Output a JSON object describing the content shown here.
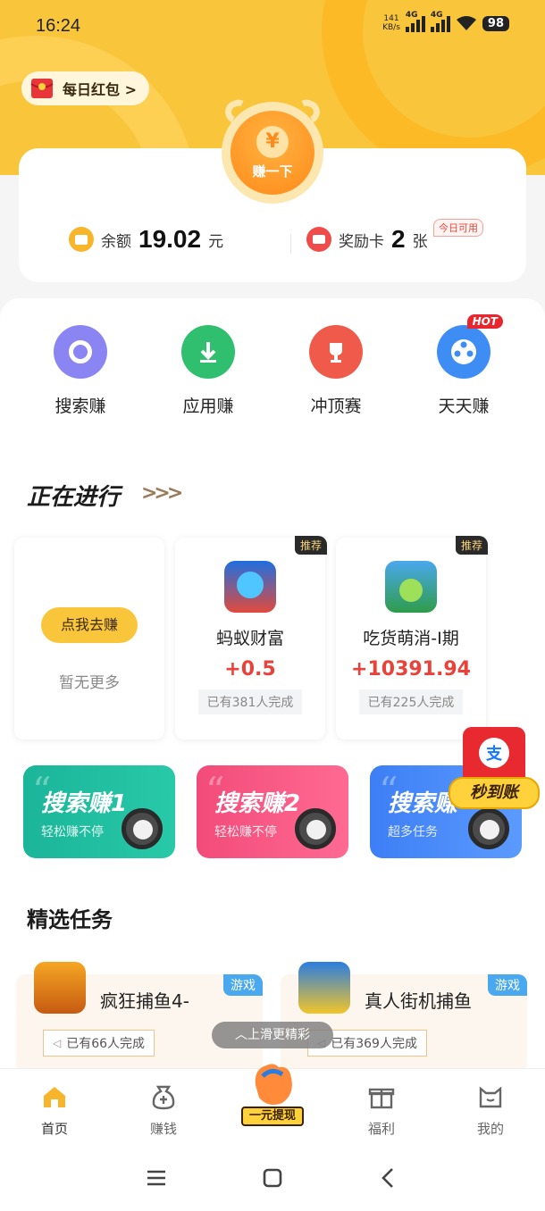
{
  "status": {
    "time": "16:24",
    "speed": "141",
    "speed_unit": "KB/s",
    "net1": "4G",
    "net2": "4G",
    "battery": "98"
  },
  "header": {
    "daily_redpacket": "每日红包 >",
    "coin_label": "赚一下",
    "coin_symbol": "¥"
  },
  "balance": {
    "label": "余额",
    "value": "19.02",
    "unit": "元",
    "card_label": "奖励卡",
    "card_value": "2",
    "card_unit": "张",
    "badge": "今日可用"
  },
  "quick": [
    {
      "label": "搜索赚",
      "icon": "search-icon",
      "color": "#7b7ff0"
    },
    {
      "label": "应用赚",
      "icon": "download-icon",
      "color": "#2fbf6e"
    },
    {
      "label": "冲顶赛",
      "icon": "trophy-icon",
      "color": "#f05a4a"
    },
    {
      "label": "天天赚",
      "icon": "film-reel-icon",
      "color": "#3d8df5",
      "badge": "HOT"
    }
  ],
  "ongoing": {
    "title": "正在进行",
    "arrows": ">>>",
    "empty_button": "点我去赚",
    "empty_text": "暂无更多",
    "items": [
      {
        "name": "蚂蚁财富",
        "reward": "+0.5",
        "done": "已有381人完成",
        "tag": "推荐"
      },
      {
        "name": "吃货萌消-Ⅰ期",
        "reward": "+10391.94",
        "done": "已有225人完成",
        "tag": "推荐"
      }
    ]
  },
  "banners": [
    {
      "title": "搜索赚1",
      "sub": "轻松赚不停",
      "quote": "“"
    },
    {
      "title": "搜索赚2",
      "sub": "轻松赚不停",
      "quote": "“"
    },
    {
      "title": "搜索赚",
      "sub": "超多任务",
      "quote": "“"
    }
  ],
  "alipay": {
    "symbol": "支",
    "label": "秒到账"
  },
  "selected": {
    "title": "精选任务",
    "items": [
      {
        "name": "疯狂捕鱼4-",
        "tag": "游戏",
        "done": "已有66人完成"
      },
      {
        "name": "真人街机捕鱼",
        "tag": "游戏",
        "done": "已有369人完成"
      }
    ]
  },
  "toast": "上滑更精彩",
  "nav": {
    "home": "首页",
    "earn": "赚钱",
    "withdraw": "一元提现",
    "welfare": "福利",
    "mine": "我的"
  }
}
